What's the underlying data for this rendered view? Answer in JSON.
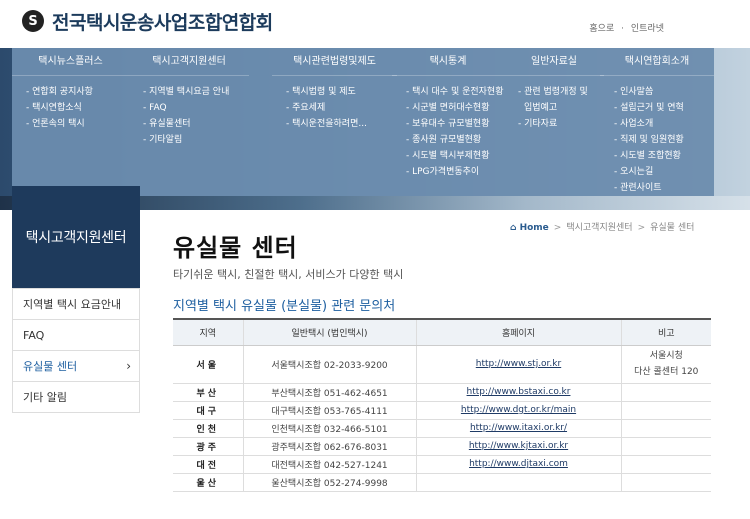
{
  "header": {
    "logo_mark": "S",
    "site_title": "전국택시운송사업조합연합회",
    "util_links": [
      "홈으로",
      "·",
      "인트라넷"
    ]
  },
  "nav": [
    {
      "label": "택시뉴스플러스",
      "items": [
        "연합회 공지사항",
        "택시연합소식",
        "언론속의 택시"
      ]
    },
    {
      "label": "택시고객지원센터",
      "items": [
        "지역별 택시요금 안내",
        "FAQ",
        "유실물센터",
        "기타알림"
      ]
    },
    {
      "label": "택시관련법령및제도",
      "items": [
        "택시법령 및 제도",
        "주요세제",
        "택시운전을하려면..."
      ]
    },
    {
      "label": "택시통계",
      "items": [
        "택시 대수 및 운전자현황",
        "시군별 면허대수현황",
        "보유대수 규모별현황",
        "종사원 규모별현황",
        "시도별 택시부제현황",
        "LPG가격변동추이"
      ]
    },
    {
      "label": "일반자료실",
      "items": [
        "관련 법령개정 및",
        "입법예고",
        "기타자료"
      ]
    },
    {
      "label": "택시연합회소개",
      "items": [
        "인사말씀",
        "설립근거 및 연혁",
        "사업소개",
        "직제 및 임원현황",
        "시도별 조합현황",
        "오시는길",
        "관련사이트"
      ]
    }
  ],
  "sidebar": {
    "title": "택시고객지원센터",
    "items": [
      {
        "label": "지역별 택시 요금안내"
      },
      {
        "label": "FAQ"
      },
      {
        "label": "유실물 센터",
        "chevron": "›"
      },
      {
        "label": "기타 알림"
      }
    ]
  },
  "breadcrumb": {
    "home": "Home",
    "sep1": ">",
    "section": "택시고객지원센터",
    "sep2": ">",
    "current": "유실물 센터"
  },
  "page": {
    "title": "유실물 센터",
    "description": "타기쉬운 택시, 친절한 택시, 서비스가 다양한 택시",
    "section_title": "지역별 택시 유실물 (분실물) 관련 문의처"
  },
  "table": {
    "headers": [
      "지역",
      "일반택시 (법인택시)",
      "홈페이지",
      "비고"
    ],
    "rows": [
      {
        "region": "서울",
        "contact": "서울택시조합 02-2033-9200",
        "url": "http://www.stj.or.kr",
        "note1": "서울시청",
        "note2": "다산 콜센터 120"
      },
      {
        "region": "부산",
        "contact": "부산택시조합 051-462-4651",
        "url": "http://www.bstaxi.co.kr",
        "note1": "",
        "note2": ""
      },
      {
        "region": "대구",
        "contact": "대구택시조합 053-765-4111",
        "url": "http://www.dgt.or.kr/main",
        "note1": "",
        "note2": ""
      },
      {
        "region": "인천",
        "contact": "인천택시조합 032-466-5101",
        "url": "http://www.itaxi.or.kr/",
        "note1": "",
        "note2": ""
      },
      {
        "region": "광주",
        "contact": "광주택시조합 062-676-8031",
        "url": "http://www.kjtaxi.or.kr",
        "note1": "",
        "note2": ""
      },
      {
        "region": "대전",
        "contact": "대전택시조합 042-527-1241",
        "url": "http://www.djtaxi.com",
        "note1": "",
        "note2": ""
      },
      {
        "region": "울산",
        "contact": "울산택시조합 052-274-9998",
        "url": "",
        "note1": "",
        "note2": ""
      }
    ]
  }
}
